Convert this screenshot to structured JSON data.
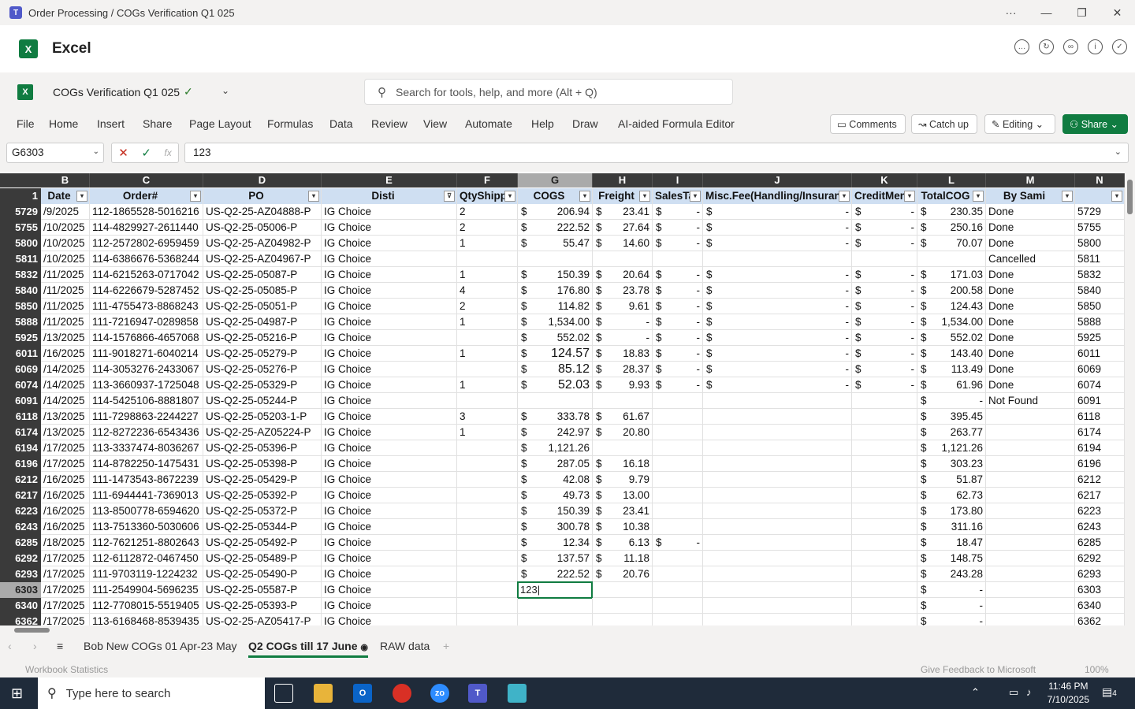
{
  "window": {
    "title": "Order Processing / COGs Verification Q1 025",
    "controls": [
      "···",
      "—",
      "❐",
      "✕"
    ]
  },
  "app": {
    "name": "Excel"
  },
  "doc": {
    "name": "COGs Verification Q1 025",
    "search_placeholder": "Search for tools, help, and more (Alt + Q)"
  },
  "menu": {
    "items": [
      "File",
      "Home",
      "Insert",
      "Share",
      "Page Layout",
      "Formulas",
      "Data",
      "Review",
      "View",
      "Automate",
      "Help",
      "Draw",
      "AI-aided Formula Editor"
    ],
    "comments": "Comments",
    "catchup": "Catch up",
    "editing": "Editing",
    "share": "Share"
  },
  "formula_bar": {
    "name_box": "G6303",
    "value": "123"
  },
  "columns": [
    "B",
    "C",
    "D",
    "E",
    "F",
    "G",
    "H",
    "I",
    "J",
    "K",
    "L",
    "M",
    "N"
  ],
  "header_row": {
    "num": "1",
    "cells": [
      "Date",
      "Order#",
      "PO",
      "Disti",
      "QtyShipp",
      "COGS",
      "Freight",
      "SalesTa",
      "Misc.Fee(Handling/Insuranc",
      "CreditMen",
      "TotalCOG",
      "By Sami",
      ""
    ]
  },
  "rows": [
    {
      "n": "5729",
      "b": "/9/2025",
      "c": "112-1865528-5016216",
      "d": "US-Q2-25-AZ04888-P",
      "e": "IG Choice",
      "f": "2",
      "g": "206.94",
      "h": "23.41",
      "i": "-",
      "j": "-",
      "k": "-",
      "l": "230.35",
      "m": "Done"
    },
    {
      "n": "5755",
      "b": "/10/2025",
      "c": "114-4829927-2611440",
      "d": "US-Q2-25-05006-P",
      "e": "IG Choice",
      "f": "2",
      "g": "222.52",
      "h": "27.64",
      "i": "-",
      "j": "-",
      "k": "-",
      "l": "250.16",
      "m": "Done"
    },
    {
      "n": "5800",
      "b": "/10/2025",
      "c": "112-2572802-6959459",
      "d": "US-Q2-25-AZ04982-P",
      "e": "IG Choice",
      "f": "1",
      "g": "55.47",
      "h": "14.60",
      "i": "-",
      "j": "-",
      "k": "-",
      "l": "70.07",
      "m": "Done"
    },
    {
      "n": "5811",
      "b": "/10/2025",
      "c": "114-6386676-5368244",
      "d": "US-Q2-25-AZ04967-P",
      "e": "IG Choice",
      "f": "",
      "g": "",
      "h": "",
      "i": "",
      "j": "",
      "k": "",
      "l": "",
      "m": "Cancelled"
    },
    {
      "n": "5832",
      "b": "/11/2025",
      "c": "114-6215263-0717042",
      "d": "US-Q2-25-05087-P",
      "e": "IG Choice",
      "f": "1",
      "g": "150.39",
      "h": "20.64",
      "i": "-",
      "j": "-",
      "k": "-",
      "l": "171.03",
      "m": "Done"
    },
    {
      "n": "5840",
      "b": "/11/2025",
      "c": "114-6226679-5287452",
      "d": "US-Q2-25-05085-P",
      "e": "IG Choice",
      "f": "4",
      "g": "176.80",
      "h": "23.78",
      "i": "-",
      "j": "-",
      "k": "-",
      "l": "200.58",
      "m": "Done"
    },
    {
      "n": "5850",
      "b": "/11/2025",
      "c": "111-4755473-8868243",
      "d": "US-Q2-25-05051-P",
      "e": "IG Choice",
      "f": "2",
      "g": "114.82",
      "h": "9.61",
      "i": "-",
      "j": "-",
      "k": "-",
      "l": "124.43",
      "m": "Done"
    },
    {
      "n": "5888",
      "b": "/11/2025",
      "c": "111-7216947-0289858",
      "d": "US-Q2-25-04987-P",
      "e": "IG Choice",
      "f": "1",
      "g": "1,534.00",
      "h": "-",
      "i": "-",
      "j": "-",
      "k": "-",
      "l": "1,534.00",
      "m": "Done"
    },
    {
      "n": "5925",
      "b": "/13/2025",
      "c": "114-1576866-4657068",
      "d": "US-Q2-25-05216-P",
      "e": "IG Choice",
      "f": "",
      "g": "552.02",
      "h": "-",
      "i": "-",
      "j": "-",
      "k": "-",
      "l": "552.02",
      "m": "Done"
    },
    {
      "n": "6011",
      "b": "/16/2025",
      "c": "111-9018271-6040214",
      "d": "US-Q2-25-05279-P",
      "e": "IG Choice",
      "f": "1",
      "g": "124.57",
      "h": "18.83",
      "i": "-",
      "j": "-",
      "k": "-",
      "l": "143.40",
      "m": "Done",
      "big": true
    },
    {
      "n": "6069",
      "b": "/14/2025",
      "c": "114-3053276-2433067",
      "d": "US-Q2-25-05276-P",
      "e": "IG Choice",
      "f": "",
      "g": "85.12",
      "h": "28.37",
      "i": "-",
      "j": "-",
      "k": "-",
      "l": "113.49",
      "m": "Done",
      "big": true
    },
    {
      "n": "6074",
      "b": "/14/2025",
      "c": "113-3660937-1725048",
      "d": "US-Q2-25-05329-P",
      "e": "IG Choice",
      "f": "1",
      "g": "52.03",
      "h": "9.93",
      "i": "-",
      "j": "-",
      "k": "-",
      "l": "61.96",
      "m": "Done",
      "big": true
    },
    {
      "n": "6091",
      "b": "/14/2025",
      "c": "114-5425106-8881807",
      "d": "US-Q2-25-05244-P",
      "e": "IG Choice",
      "f": "",
      "g": "",
      "h": "",
      "i": "",
      "j": "",
      "k": "",
      "l": "-",
      "m": "Not Found"
    },
    {
      "n": "6118",
      "b": "/13/2025",
      "c": "111-7298863-2244227",
      "d": "US-Q2-25-05203-1-P",
      "e": "IG Choice",
      "f": "3",
      "g": "333.78",
      "h": "61.67",
      "i": "",
      "j": "",
      "k": "",
      "l": "395.45",
      "m": ""
    },
    {
      "n": "6174",
      "b": "/13/2025",
      "c": "112-8272236-6543436",
      "d": "US-Q2-25-AZ05224-P",
      "e": "IG Choice",
      "f": "1",
      "g": "242.97",
      "h": "20.80",
      "i": "",
      "j": "",
      "k": "",
      "l": "263.77",
      "m": ""
    },
    {
      "n": "6194",
      "b": "/17/2025",
      "c": "113-3337474-8036267",
      "d": "US-Q2-25-05396-P",
      "e": "IG Choice",
      "f": "",
      "g": "1,121.26",
      "h": "",
      "i": "",
      "j": "",
      "k": "",
      "l": "1,121.26",
      "m": ""
    },
    {
      "n": "6196",
      "b": "/17/2025",
      "c": "114-8782250-1475431",
      "d": "US-Q2-25-05398-P",
      "e": "IG Choice",
      "f": "",
      "g": "287.05",
      "h": "16.18",
      "i": "",
      "j": "",
      "k": "",
      "l": "303.23",
      "m": ""
    },
    {
      "n": "6212",
      "b": "/16/2025",
      "c": "111-1473543-8672239",
      "d": "US-Q2-25-05429-P",
      "e": "IG Choice",
      "f": "",
      "g": "42.08",
      "h": "9.79",
      "i": "",
      "j": "",
      "k": "",
      "l": "51.87",
      "m": ""
    },
    {
      "n": "6217",
      "b": "/16/2025",
      "c": "111-6944441-7369013",
      "d": "US-Q2-25-05392-P",
      "e": "IG Choice",
      "f": "",
      "g": "49.73",
      "h": "13.00",
      "i": "",
      "j": "",
      "k": "",
      "l": "62.73",
      "m": ""
    },
    {
      "n": "6223",
      "b": "/16/2025",
      "c": "113-8500778-6594620",
      "d": "US-Q2-25-05372-P",
      "e": "IG Choice",
      "f": "",
      "g": "150.39",
      "h": "23.41",
      "i": "",
      "j": "",
      "k": "",
      "l": "173.80",
      "m": ""
    },
    {
      "n": "6243",
      "b": "/16/2025",
      "c": "113-7513360-5030606",
      "d": "US-Q2-25-05344-P",
      "e": "IG Choice",
      "f": "",
      "g": "300.78",
      "h": "10.38",
      "i": "",
      "j": "",
      "k": "",
      "l": "311.16",
      "m": ""
    },
    {
      "n": "6285",
      "b": "/18/2025",
      "c": "112-7621251-8802643",
      "d": "US-Q2-25-05492-P",
      "e": "IG Choice",
      "f": "",
      "g": "12.34",
      "h": "6.13",
      "i": "-",
      "j": "",
      "k": "",
      "l": "18.47",
      "m": ""
    },
    {
      "n": "6292",
      "b": "/17/2025",
      "c": "112-6112872-0467450",
      "d": "US-Q2-25-05489-P",
      "e": "IG Choice",
      "f": "",
      "g": "137.57",
      "h": "11.18",
      "i": "",
      "j": "",
      "k": "",
      "l": "148.75",
      "m": ""
    },
    {
      "n": "6293",
      "b": "/17/2025",
      "c": "111-9703119-1224232",
      "d": "US-Q2-25-05490-P",
      "e": "IG Choice",
      "f": "",
      "g": "222.52",
      "h": "20.76",
      "i": "",
      "j": "",
      "k": "",
      "l": "243.28",
      "m": ""
    },
    {
      "n": "6303",
      "b": "/17/2025",
      "c": "111-2549904-5696235",
      "d": "US-Q2-25-05587-P",
      "e": "IG Choice",
      "f": "",
      "g": "",
      "h": "",
      "i": "",
      "j": "",
      "k": "",
      "l": "-",
      "m": "",
      "active": "123"
    },
    {
      "n": "6340",
      "b": "/17/2025",
      "c": "112-7708015-5519405",
      "d": "US-Q2-25-05393-P",
      "e": "IG Choice",
      "f": "",
      "g": "",
      "h": "",
      "i": "",
      "j": "",
      "k": "",
      "l": "-",
      "m": ""
    },
    {
      "n": "6362",
      "b": "/17/2025",
      "c": "113-6168468-8539435",
      "d": "US-Q2-25-AZ05417-P",
      "e": "IG Choice",
      "f": "",
      "g": "",
      "h": "",
      "i": "",
      "j": "",
      "k": "",
      "l": "-",
      "m": ""
    }
  ],
  "sheets": {
    "tabs": [
      "Bob New COGs 01 Apr-23 May",
      "Q2 COGs till 17 June",
      "RAW data"
    ],
    "active": "Q2 COGs till 17 June"
  },
  "status": {
    "left": "Workbook Statistics",
    "feedback": "Give Feedback to Microsoft",
    "zoom": "100%"
  },
  "taskbar": {
    "search": "Type here to search",
    "time": "11:46 PM",
    "date": "7/10/2025",
    "notif": "4"
  },
  "colors": {
    "accent": "#107c41",
    "header_bg": "#3a3a3a",
    "filter_row": "#cfdff2"
  }
}
